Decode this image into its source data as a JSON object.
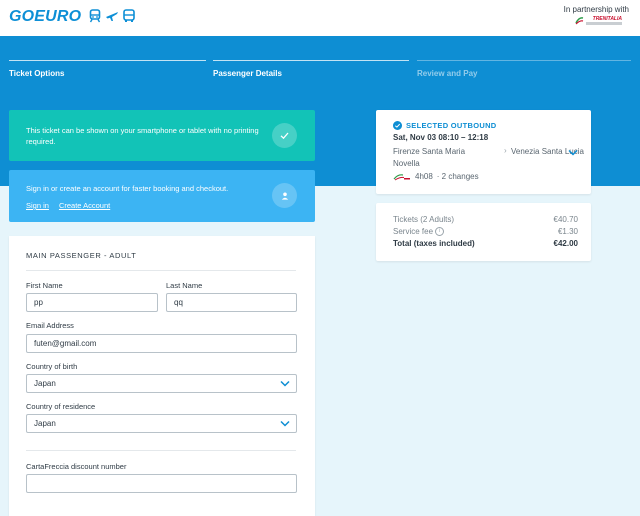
{
  "header": {
    "logo": "GOEURO",
    "partner_label": "In partnership with",
    "partner_name": "TRENITALIA"
  },
  "steps": [
    {
      "label": "Ticket Options",
      "state": "done"
    },
    {
      "label": "Passenger Details",
      "state": "active"
    },
    {
      "label": "Review and Pay",
      "state": "future"
    }
  ],
  "notices": {
    "phone_text": "This ticket can be shown on your smartphone or tablet with no printing required.",
    "signin_text": "Sign in or create an account for faster booking and checkout.",
    "signin_link": "Sign in",
    "create_account_link": "Create Account"
  },
  "form": {
    "title": "MAIN PASSENGER - ADULT",
    "first_name_label": "First Name",
    "first_name_value": "pp",
    "last_name_label": "Last Name",
    "last_name_value": "qq",
    "email_label": "Email Address",
    "email_value": "futen@gmail.com",
    "birth_country_label": "Country of birth",
    "birth_country_value": "Japan",
    "residence_country_label": "Country of residence",
    "residence_country_value": "Japan",
    "discount_label": "CartaFreccia discount number",
    "discount_value": ""
  },
  "trip": {
    "selected_label": "SELECTED OUTBOUND",
    "date_time": "Sat, Nov 03   08:10 – 12:18",
    "from": "Firenze Santa Maria Novella",
    "to": "Venezia Santa Lucia",
    "duration": "4h08",
    "changes": "· 2 changes"
  },
  "price": {
    "tickets_label": "Tickets  (2 Adults)",
    "tickets_value": "€40.70",
    "fee_label": "Service fee",
    "fee_value": "€1.30",
    "total_label": "Total (taxes included)",
    "total_value": "€42.00"
  },
  "colors": {
    "brand_blue": "#0e8ed3",
    "teal_notice": "#12c3b7",
    "light_blue_notice": "#3cb4f3",
    "page_bg": "#e6f5fb"
  }
}
